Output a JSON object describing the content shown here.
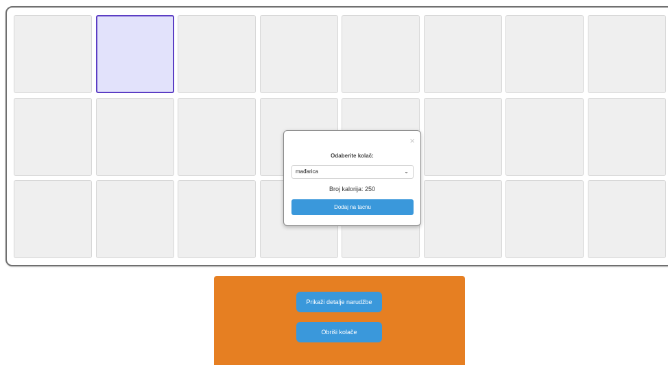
{
  "modal": {
    "close_glyph": "×",
    "title": "Odaberite kolač:",
    "select_value": "mađarica",
    "chevron_glyph": "⌄",
    "calories_text": "Broj kalorija: 250",
    "add_button": "Dodaj na tacnu"
  },
  "controls": {
    "details_button": "Prikaži detalje narudžbe",
    "delete_button": "Obriši kolače"
  },
  "tray": {
    "rows": 3,
    "cols": 8,
    "selected_slot": 1
  },
  "colors": {
    "accent_blue": "#3a98db",
    "panel_orange": "#e67f22",
    "selected_border": "#5b3dc4",
    "selected_fill": "#e2e2fb"
  }
}
